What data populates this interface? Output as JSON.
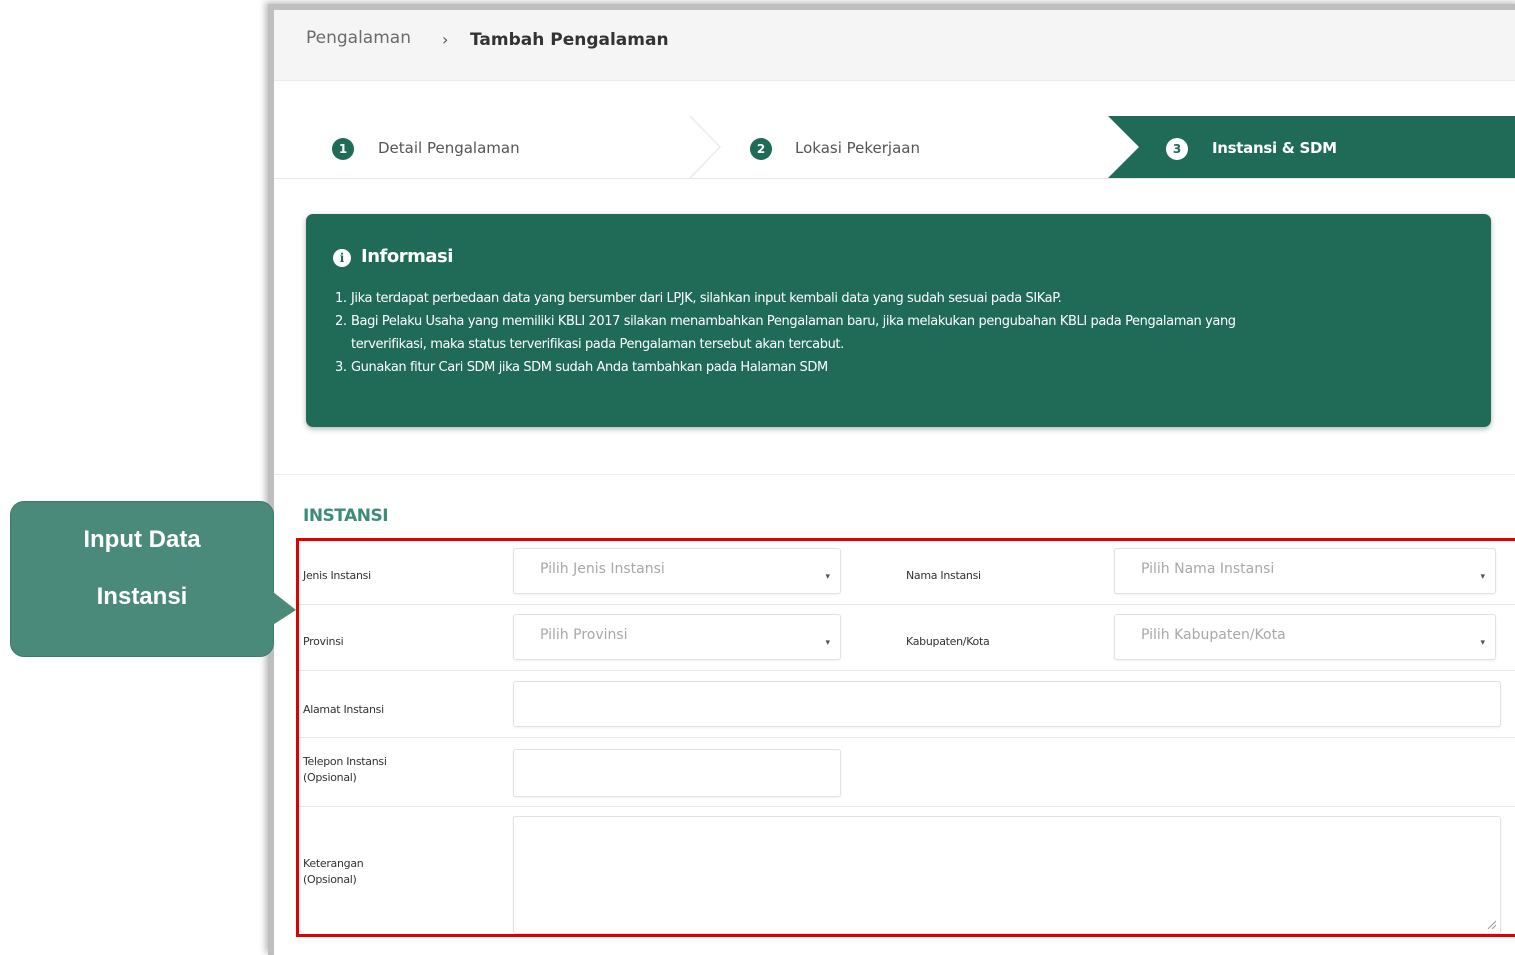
{
  "breadcrumb": {
    "parent": "Pengalaman",
    "separator": "›",
    "current": "Tambah Pengalaman"
  },
  "steps": [
    {
      "number": "1",
      "label": "Detail Pengalaman",
      "active": false
    },
    {
      "number": "2",
      "label": "Lokasi Pekerjaan",
      "active": false
    },
    {
      "number": "3",
      "label": "Instansi & SDM",
      "active": true
    }
  ],
  "info": {
    "icon": "info-icon",
    "title": "Informasi",
    "items": [
      {
        "number": "1.",
        "text": "Jika terdapat perbedaan data yang bersumber dari LPJK, silahkan input kembali data yang sudah sesuai pada SIKaP."
      },
      {
        "number": "2.",
        "text": "Bagi Pelaku Usaha yang memiliki KBLI 2017 silakan menambahkan Pengalaman baru, jika melakukan pengubahan KBLI pada Pengalaman yang",
        "continuation": "terverifikasi, maka status terverifikasi pada Pengalaman tersebut akan tercabut."
      },
      {
        "number": "3.",
        "text": "Gunakan fitur Cari SDM jika SDM sudah Anda tambahkan pada Halaman SDM"
      }
    ]
  },
  "section": {
    "title": "INSTANSI"
  },
  "form": {
    "jenis_instansi": {
      "label": "Jenis Instansi",
      "placeholder": "Pilih Jenis Instansi",
      "caret": "▾"
    },
    "nama_instansi": {
      "label": "Nama Instansi",
      "placeholder": "Pilih Nama Instansi",
      "caret": "▾"
    },
    "provinsi": {
      "label": "Provinsi",
      "placeholder": "Pilih Provinsi",
      "caret": "▾"
    },
    "kabupaten": {
      "label": "Kabupaten/Kota",
      "placeholder": "Pilih Kabupaten/Kota",
      "caret": "▾"
    },
    "alamat": {
      "label": "Alamat Instansi",
      "value": ""
    },
    "telepon": {
      "label_line1": "Telepon Instansi",
      "label_line2": "(Opsional)",
      "value": ""
    },
    "keterangan": {
      "label_line1": "Keterangan",
      "label_line2": "(Opsional)",
      "value": ""
    }
  },
  "callout": {
    "line1": "Input Data",
    "line2": "Instansi"
  },
  "colors": {
    "brand_green": "#1f6b57",
    "callout_green": "#4a8a7a",
    "highlight_red": "#e00000",
    "section_title": "#3d8c79"
  }
}
